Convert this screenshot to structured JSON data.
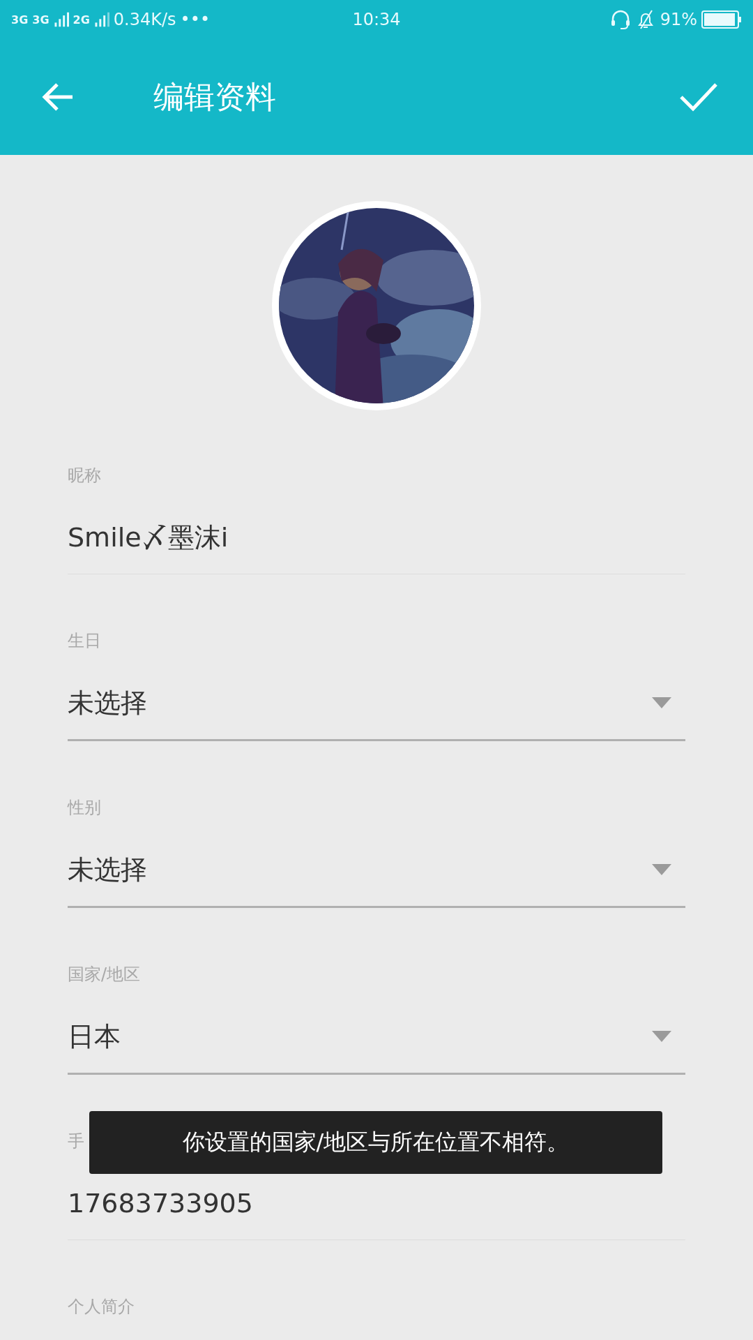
{
  "status_bar": {
    "network_1": "3G",
    "network_2": "3G",
    "network_3": "2G",
    "speed": "0.34K/s",
    "more": "•••",
    "time": "10:34",
    "battery": "91%"
  },
  "header": {
    "title": "编辑资料"
  },
  "fields": [
    {
      "kind": "text",
      "label": "昵称",
      "value": "Smile〆墨沫i"
    },
    {
      "kind": "select",
      "label": "生日",
      "value": "未选择"
    },
    {
      "kind": "select",
      "label": "性别",
      "value": "未选择"
    },
    {
      "kind": "select",
      "label": "国家/地区",
      "value": "日本"
    },
    {
      "kind": "text",
      "label": "手",
      "value": "17683733905"
    },
    {
      "label": "个人简介"
    }
  ],
  "toast": {
    "text": "你设置的国家/地区与所在位置不相符。"
  }
}
